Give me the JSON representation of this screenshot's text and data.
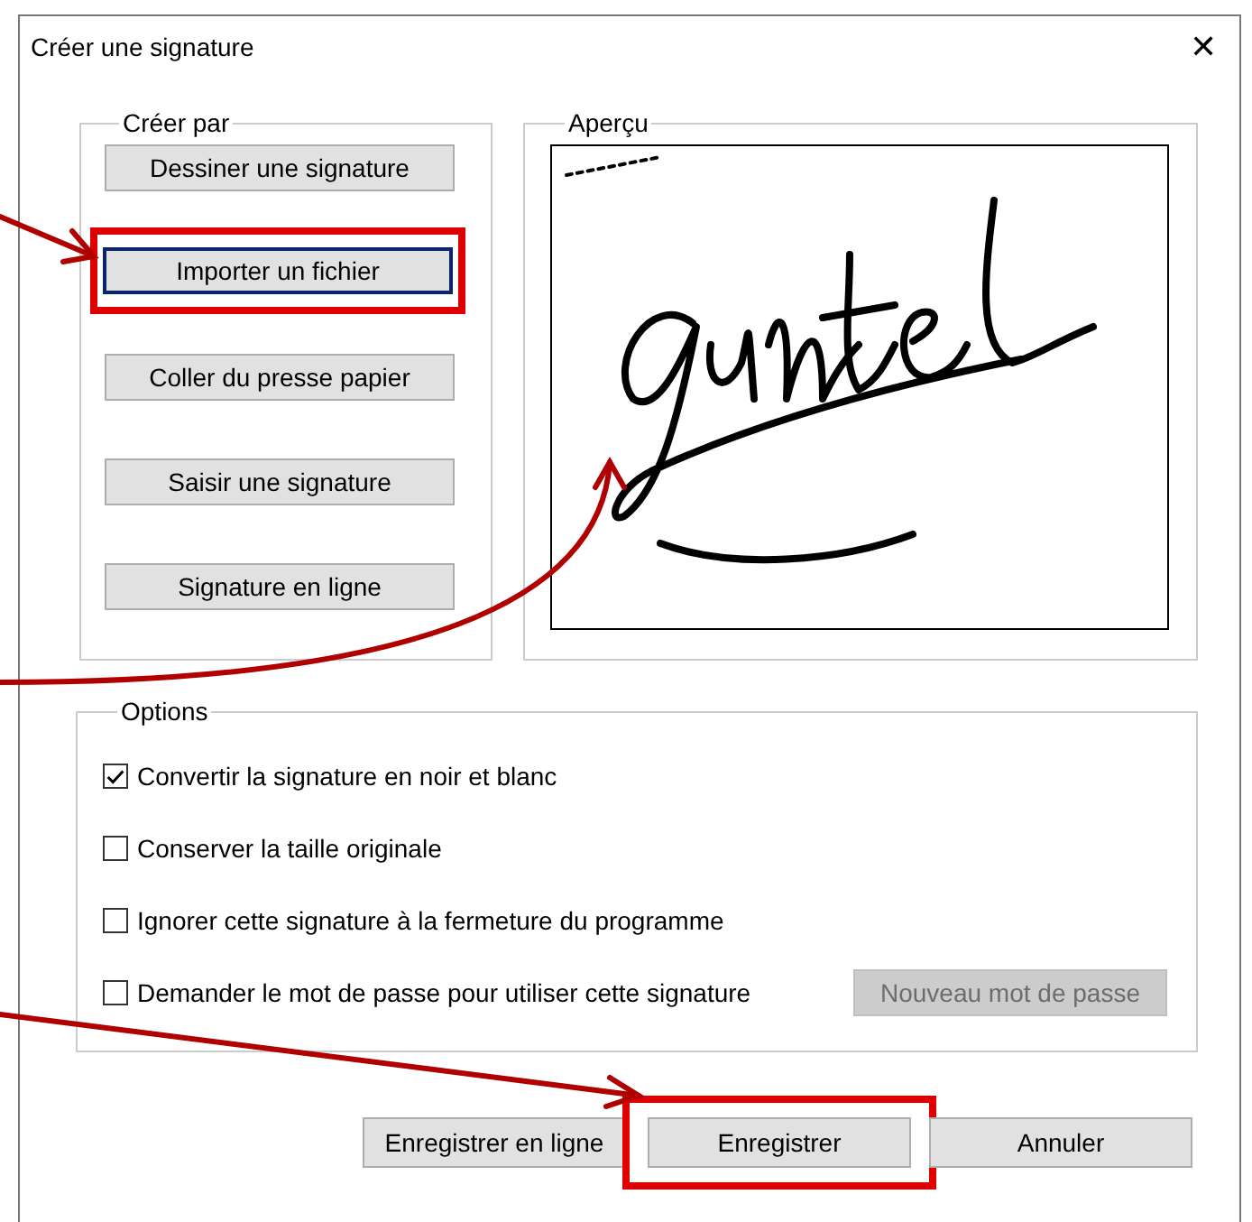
{
  "window": {
    "title": "Créer une signature",
    "close": "✕"
  },
  "create_by": {
    "title": "Créer par",
    "buttons": [
      {
        "label": "Dessiner une signature",
        "focused": false,
        "highlighted": false
      },
      {
        "label": "Importer un fichier",
        "focused": true,
        "highlighted": true
      },
      {
        "label": "Coller du presse papier",
        "focused": false,
        "highlighted": false
      },
      {
        "label": "Saisir une signature",
        "focused": false,
        "highlighted": false
      },
      {
        "label": "Signature en ligne",
        "focused": false,
        "highlighted": false
      }
    ]
  },
  "preview": {
    "title": "Aperçu"
  },
  "options": {
    "title": "Options",
    "items": [
      {
        "label": "Convertir la signature en noir et blanc",
        "checked": true
      },
      {
        "label": "Conserver la taille originale",
        "checked": false
      },
      {
        "label": "Ignorer cette signature à la fermeture du programme",
        "checked": false
      },
      {
        "label": "Demander le mot de passe pour utiliser cette signature",
        "checked": false,
        "button": {
          "label": "Nouveau mot de passe",
          "disabled": true
        }
      }
    ]
  },
  "footer_buttons": [
    {
      "label": "Enregistrer en ligne",
      "highlighted": false
    },
    {
      "label": "Enregistrer",
      "highlighted": true
    },
    {
      "label": "Annuler",
      "highlighted": false
    }
  ]
}
